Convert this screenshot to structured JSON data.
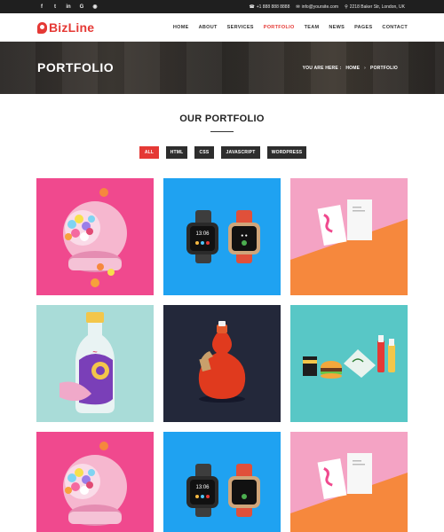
{
  "topbar": {
    "social": [
      "f",
      "t",
      "in",
      "G",
      "rss"
    ],
    "phone": "+1 888 888 8888",
    "email": "info@yoursite.com",
    "address": "2218 Baker Str, London, UK"
  },
  "header": {
    "logo_text": "BizLine",
    "nav": [
      "HOME",
      "ABOUT",
      "SERVICES",
      "PORTFOLIO",
      "TEAM",
      "NEWS",
      "PAGES",
      "CONTACT"
    ],
    "active_nav": "PORTFOLIO"
  },
  "banner": {
    "title": "PORTFOLIO",
    "crumbs_prefix": "YOU ARE HERE :",
    "crumb_home": "HOME",
    "crumb_sep": "›",
    "crumb_current": "PORTFOLIO"
  },
  "section": {
    "title": "OUR PORTFOLIO"
  },
  "filters": [
    "ALL",
    "HTML",
    "CSS",
    "JAVASCRIPT",
    "WORDPRESS"
  ],
  "active_filter": "ALL",
  "colors": {
    "accent": "#e53935",
    "dark": "#1f1f1f",
    "tile_pink": "#f0498e",
    "tile_blue": "#1fa2f1",
    "tile_orange": "#f6883d",
    "tile_light_pink": "#f4a3c4",
    "tile_mint": "#a9dcd8",
    "tile_navy": "#23283a",
    "tile_teal": "#58c7c6"
  },
  "portfolio": [
    {
      "name": "candy-helmet-icon"
    },
    {
      "name": "smart-watches-icon"
    },
    {
      "name": "business-cards-icon"
    },
    {
      "name": "bottle-illustration-icon"
    },
    {
      "name": "red-gourd-bottle-icon"
    },
    {
      "name": "burger-branding-icon"
    },
    {
      "name": "candy-helmet-icon"
    },
    {
      "name": "smart-watches-icon"
    },
    {
      "name": "business-cards-icon"
    }
  ],
  "watch_time": "13:06"
}
